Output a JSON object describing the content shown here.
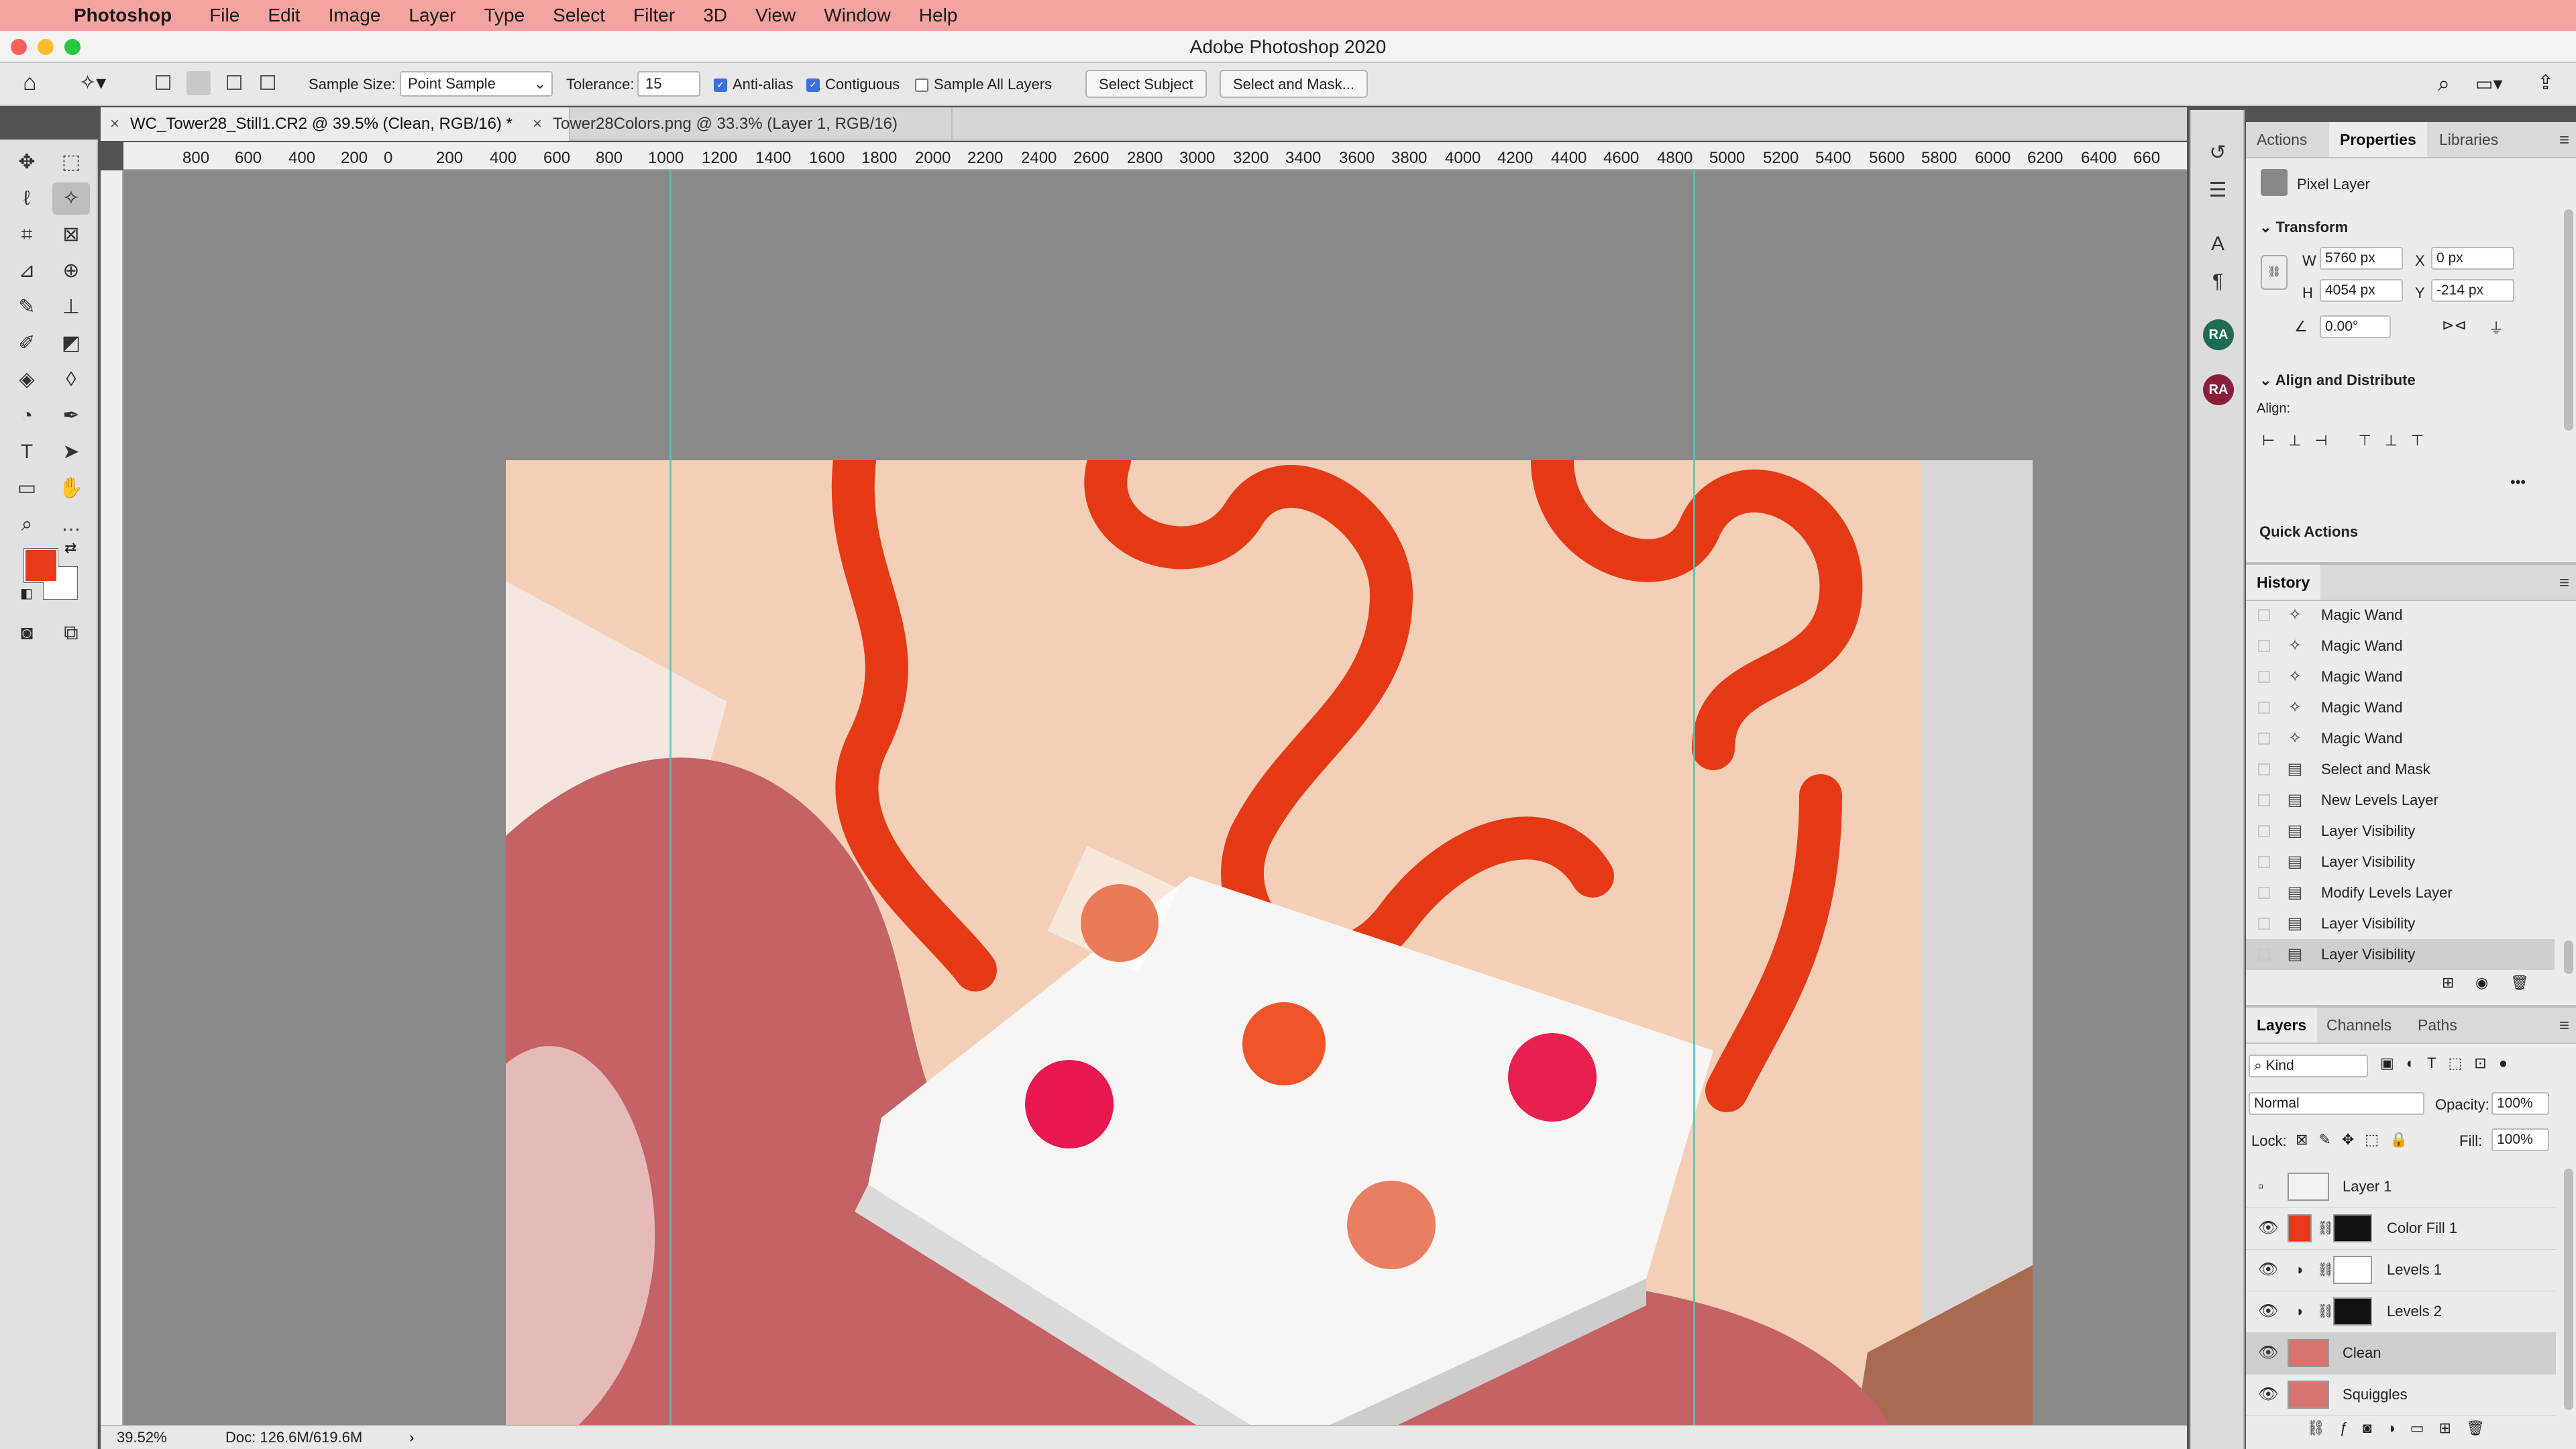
{
  "menubar": {
    "app": "Photoshop",
    "items": [
      "File",
      "Edit",
      "Image",
      "Layer",
      "Type",
      "Select",
      "Filter",
      "3D",
      "View",
      "Window",
      "Help"
    ]
  },
  "window": {
    "title": "Adobe Photoshop 2020"
  },
  "options": {
    "sample_size_label": "Sample Size:",
    "sample_size_value": "Point Sample",
    "tolerance_label": "Tolerance:",
    "tolerance_value": "15",
    "anti_alias": "Anti-alias",
    "contiguous": "Contiguous",
    "sample_all_layers": "Sample All Layers",
    "select_subject": "Select Subject",
    "select_and_mask": "Select and Mask..."
  },
  "tabs": [
    {
      "label": "WC_Tower28_Still1.CR2 @ 39.5% (Clean, RGB/16) *"
    },
    {
      "label": "Tower28Colors.png @ 33.3% (Layer 1, RGB/16)"
    }
  ],
  "ruler": [
    "800",
    "600",
    "400",
    "200",
    "0",
    "200",
    "400",
    "600",
    "800",
    "1000",
    "1200",
    "1400",
    "1600",
    "1800",
    "2000",
    "2200",
    "2400",
    "2600",
    "2800",
    "3000",
    "3200",
    "3400",
    "3600",
    "3800",
    "4000",
    "4200",
    "4400",
    "4600",
    "4800",
    "5000",
    "5200",
    "5400",
    "5600",
    "5800",
    "6000",
    "6200",
    "6400",
    "660"
  ],
  "status": {
    "zoom": "39.52%",
    "doc": "Doc: 126.6M/619.6M"
  },
  "foreground_color": "#e8391a",
  "background_color": "#ffffff",
  "avatars": [
    "RA",
    "RA"
  ],
  "properties": {
    "tabs": [
      "Actions",
      "Properties",
      "Libraries"
    ],
    "kind": "Pixel Layer",
    "transform_title": "Transform",
    "w_label": "W",
    "w_value": "5760 px",
    "h_label": "H",
    "h_value": "4054 px",
    "x_label": "X",
    "x_value": "0 px",
    "y_label": "Y",
    "y_value": "-214 px",
    "angle": "0.00°",
    "align_title": "Align and Distribute",
    "align_label": "Align:",
    "quick_actions": "Quick Actions"
  },
  "history": {
    "title": "History",
    "items": [
      {
        "label": "Magic Wand",
        "icon": "magic-wand-icon"
      },
      {
        "label": "Magic Wand",
        "icon": "magic-wand-icon"
      },
      {
        "label": "Magic Wand",
        "icon": "magic-wand-icon"
      },
      {
        "label": "Magic Wand",
        "icon": "magic-wand-icon"
      },
      {
        "label": "Magic Wand",
        "icon": "magic-wand-icon"
      },
      {
        "label": "Select and Mask",
        "icon": "document-icon"
      },
      {
        "label": "New Levels Layer",
        "icon": "document-icon"
      },
      {
        "label": "Layer Visibility",
        "icon": "document-icon"
      },
      {
        "label": "Layer Visibility",
        "icon": "document-icon"
      },
      {
        "label": "Modify Levels Layer",
        "icon": "document-icon"
      },
      {
        "label": "Layer Visibility",
        "icon": "document-icon"
      },
      {
        "label": "Layer Visibility",
        "icon": "document-icon"
      }
    ]
  },
  "layers_panel": {
    "tabs": [
      "Layers",
      "Channels",
      "Paths"
    ],
    "filter": "Kind",
    "blend_mode": "Normal",
    "opacity_label": "Opacity:",
    "opacity_value": "100%",
    "lock_label": "Lock:",
    "fill_label": "Fill:",
    "fill_value": "100%",
    "layers": [
      {
        "name": "Layer 1",
        "visible": false
      },
      {
        "name": "Color Fill 1",
        "visible": true
      },
      {
        "name": "Levels 1",
        "visible": true
      },
      {
        "name": "Levels 2",
        "visible": true
      },
      {
        "name": "Clean",
        "visible": true,
        "selected": true
      },
      {
        "name": "Squiggles",
        "visible": true
      }
    ]
  }
}
